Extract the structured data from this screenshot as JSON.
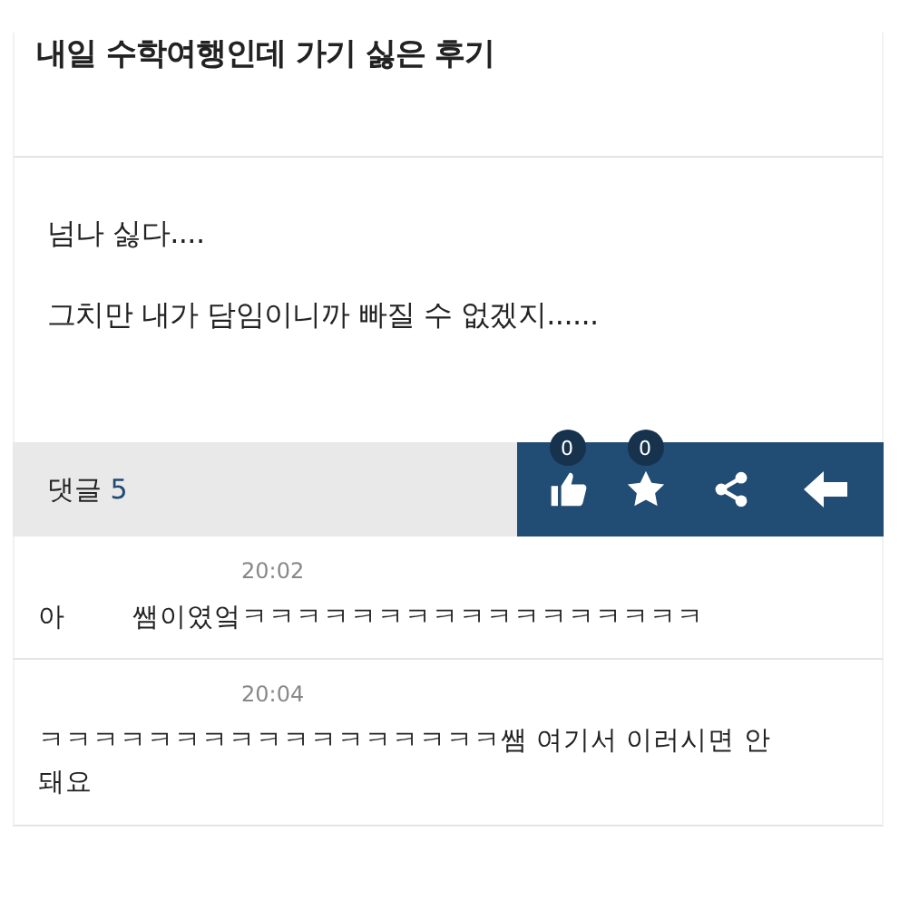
{
  "post": {
    "title": "내일 수학여행인데 가기 싫은 후기",
    "body": [
      "넘나 싫다....",
      "그치만 내가 담임이니까 빠질 수 없겠지......"
    ]
  },
  "action_bar": {
    "comments_label": "댓글",
    "comments_count": "5",
    "like_count": "0",
    "favorite_count": "0"
  },
  "comments": [
    {
      "time": "20:02",
      "text": "아        쌤이였엌ㅋㅋㅋㅋㅋㅋㅋㅋㅋㅋㅋㅋㅋㅋㅋㅋㅋ"
    },
    {
      "time": "20:04",
      "text": "ㅋㅋㅋㅋㅋㅋㅋㅋㅋㅋㅋㅋㅋㅋㅋㅋㅋ쌤 여기서 이러시면 안 돼요"
    }
  ]
}
